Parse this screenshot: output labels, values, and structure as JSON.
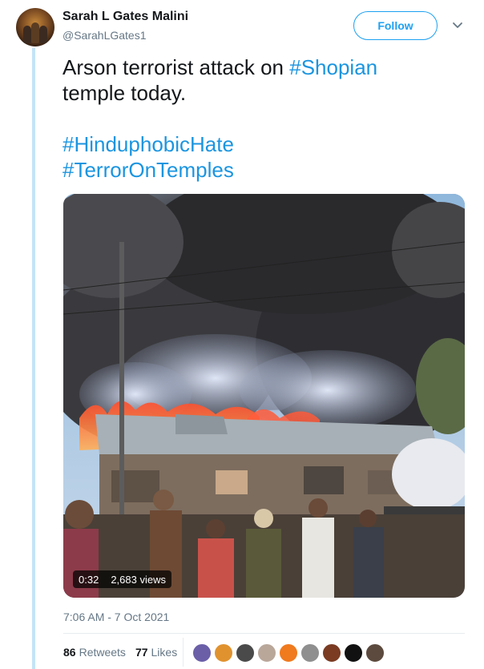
{
  "user": {
    "name": "Sarah L Gates Malini",
    "handle": "@SarahLGates1"
  },
  "follow_label": "Follow",
  "tweet": {
    "line1_text": "Arson terrorist attack on ",
    "line1_tag": "#Shopian",
    "line2_text": "temple today.",
    "tag1": "#HinduphobicHate",
    "tag2": "#TerrorOnTemples"
  },
  "media": {
    "duration": "0:32",
    "views": "2,683 views"
  },
  "timestamp": "7:06 AM - 7 Oct 2021",
  "stats": {
    "retweets_count": "86",
    "retweets_label": "Retweets",
    "likes_count": "77",
    "likes_label": "Likes"
  },
  "colors": {
    "accent": "#1da1f2",
    "hashtag": "#1b95e0",
    "thread_line": "#c4e4f6"
  },
  "likers": [
    {
      "icon": "liker-avatar",
      "color": "#6b5fa8"
    },
    {
      "icon": "liker-avatar",
      "color": "#e0922f"
    },
    {
      "icon": "liker-avatar",
      "color": "#4a4a4a"
    },
    {
      "icon": "liker-avatar",
      "color": "#b9a79a"
    },
    {
      "icon": "liker-avatar",
      "color": "#f07a1e"
    },
    {
      "icon": "liker-avatar",
      "color": "#8f8f8f"
    },
    {
      "icon": "liker-avatar",
      "color": "#7a3b22"
    },
    {
      "icon": "liker-avatar",
      "color": "#111111"
    },
    {
      "icon": "liker-avatar",
      "color": "#5c4a3e"
    }
  ]
}
